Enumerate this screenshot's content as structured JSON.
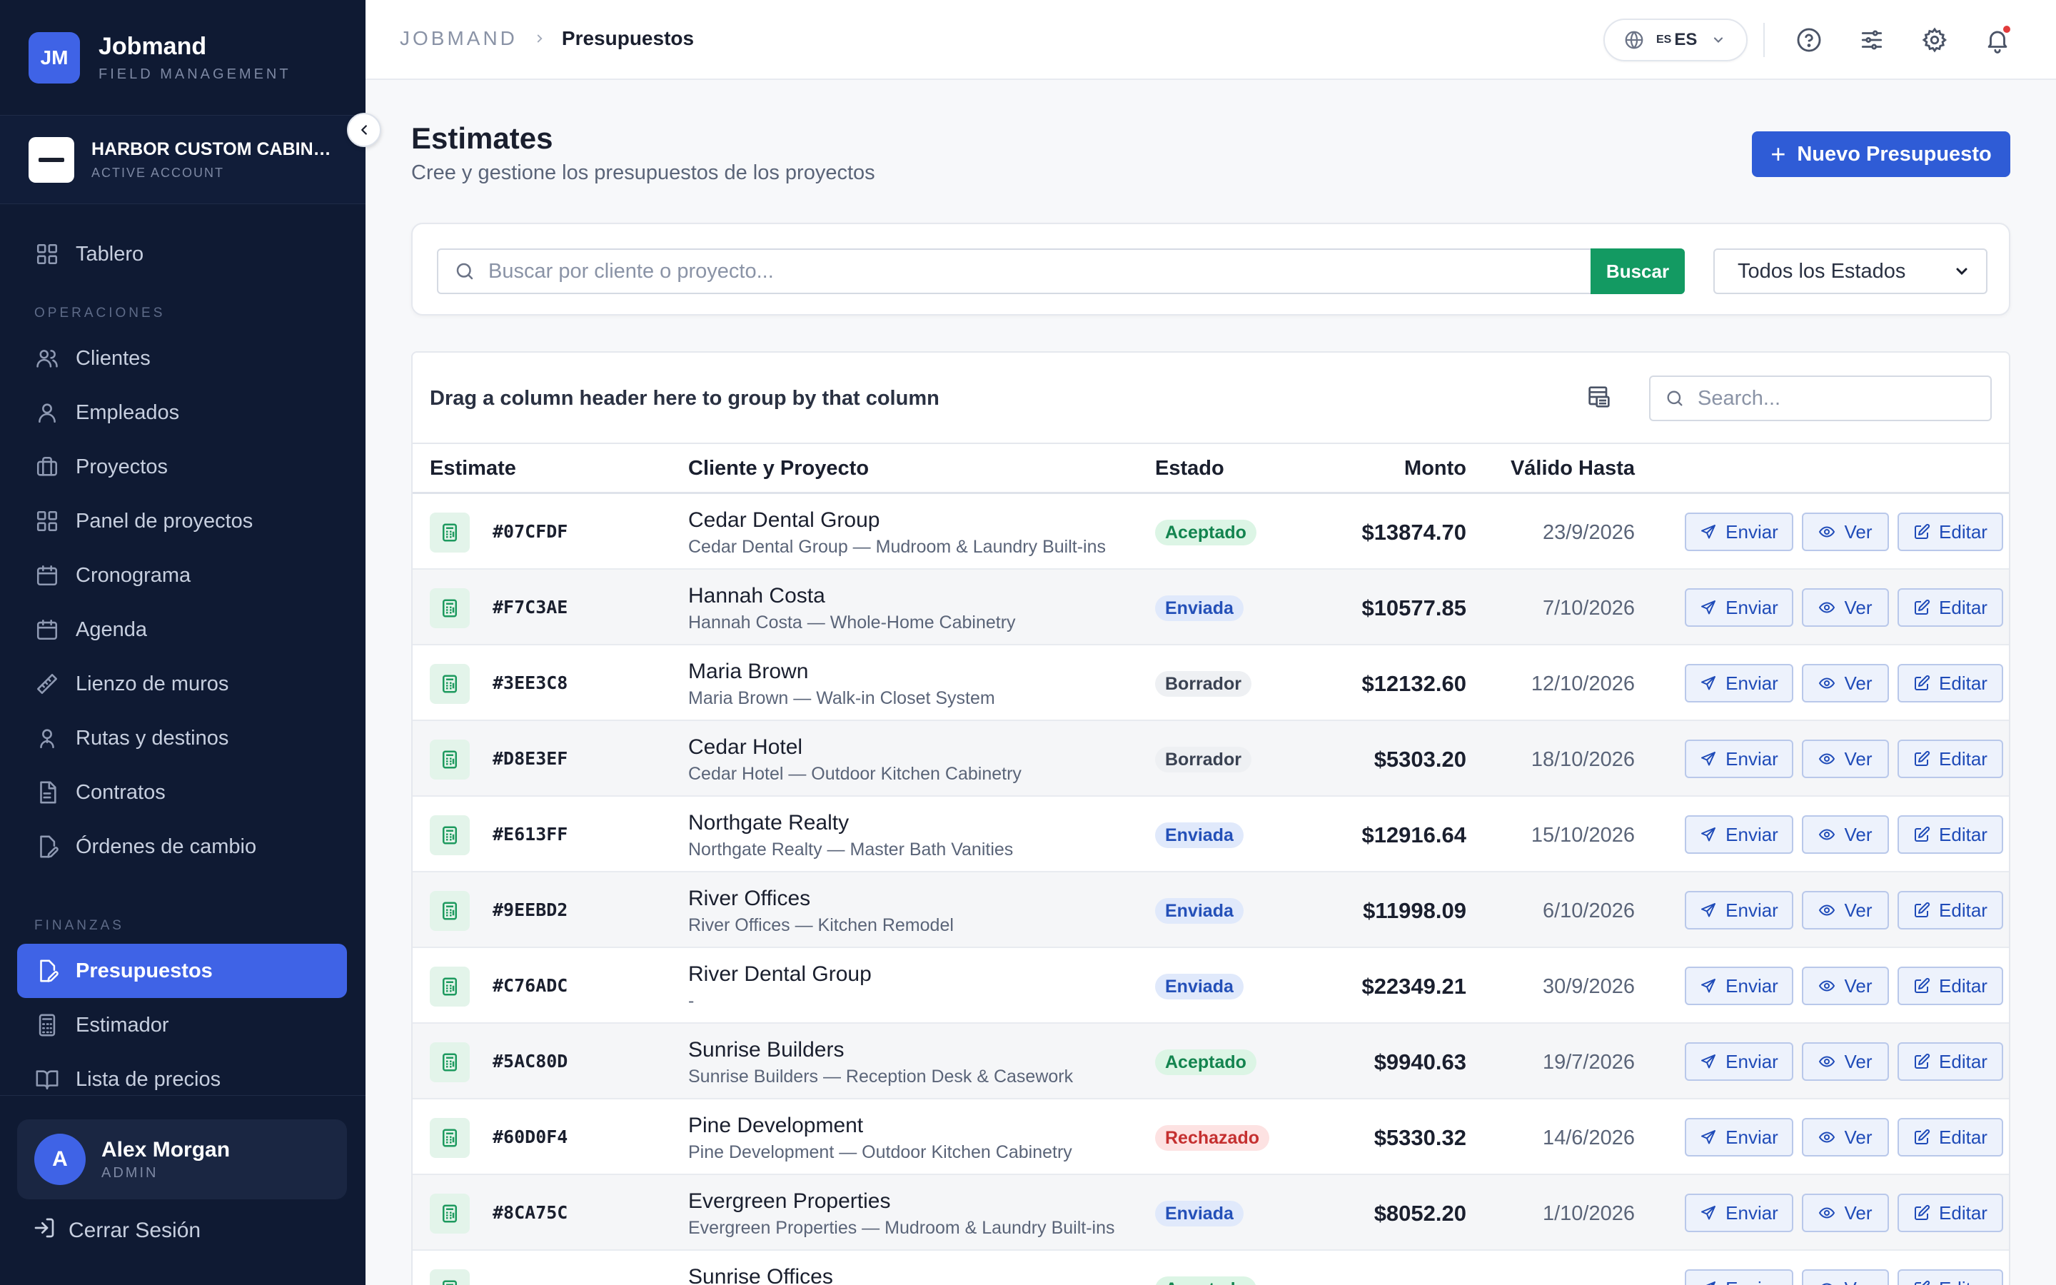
{
  "sidebar": {
    "brand_initials": "JM",
    "brand_name": "Jobmand",
    "brand_sub": "FIELD MANAGEMENT",
    "account_name": "HARBOR CUSTOM CABINETRY",
    "account_sub": "ACTIVE ACCOUNT",
    "nav_top": {
      "label": "Tablero",
      "icon": "grid-icon"
    },
    "section_ops": "OPERACIONES",
    "ops": [
      {
        "label": "Clientes",
        "icon": "users-icon"
      },
      {
        "label": "Empleados",
        "icon": "user-icon"
      },
      {
        "label": "Proyectos",
        "icon": "briefcase-icon"
      },
      {
        "label": "Panel de proyectos",
        "icon": "grid-icon"
      },
      {
        "label": "Cronograma",
        "icon": "calendar-icon"
      },
      {
        "label": "Agenda",
        "icon": "calendar-icon"
      },
      {
        "label": "Lienzo de muros",
        "icon": "ruler-icon"
      },
      {
        "label": "Rutas y destinos",
        "icon": "map-pin-icon"
      },
      {
        "label": "Contratos",
        "icon": "file-icon"
      },
      {
        "label": "Órdenes de cambio",
        "icon": "file-edit-icon"
      }
    ],
    "section_fin": "FINANZAS",
    "fin": [
      {
        "label": "Presupuestos",
        "icon": "file-edit-icon",
        "active": true
      },
      {
        "label": "Estimador",
        "icon": "calculator-icon"
      },
      {
        "label": "Lista de precios",
        "icon": "book-icon"
      }
    ],
    "user_initial": "A",
    "user_name": "Alex Morgan",
    "user_role": "ADMIN",
    "logout": "Cerrar Sesión"
  },
  "topbar": {
    "crumb_root": "JOBMAND",
    "crumb_current": "Presupuestos",
    "lang_flag": "ES",
    "lang_code": "ES"
  },
  "page": {
    "title": "Estimates",
    "subtitle": "Cree y gestione los presupuestos de los proyectos",
    "new_button": "Nuevo Presupuesto",
    "search_placeholder": "Buscar por cliente o proyecto...",
    "search_button": "Buscar",
    "status_select": "Todos los Estados"
  },
  "grid": {
    "group_hint": "Drag a column header here to group by that column",
    "search_placeholder": "Search...",
    "columns": [
      "Estimate",
      "Cliente y Proyecto",
      "Estado",
      "Monto",
      "Válido Hasta"
    ],
    "actions": {
      "send": "Enviar",
      "view": "Ver",
      "edit": "Editar"
    },
    "rows": [
      {
        "code": "#07CFDF",
        "client": "Cedar Dental Group",
        "project": "Cedar Dental Group — Mudroom & Laundry Built-ins",
        "status": "Aceptado",
        "amount": "$13874.70",
        "valid": "23/9/2026"
      },
      {
        "code": "#F7C3AE",
        "client": "Hannah Costa",
        "project": "Hannah Costa — Whole-Home Cabinetry",
        "status": "Enviada",
        "amount": "$10577.85",
        "valid": "7/10/2026"
      },
      {
        "code": "#3EE3C8",
        "client": "Maria Brown",
        "project": "Maria Brown — Walk-in Closet System",
        "status": "Borrador",
        "amount": "$12132.60",
        "valid": "12/10/2026"
      },
      {
        "code": "#D8E3EF",
        "client": "Cedar Hotel",
        "project": "Cedar Hotel — Outdoor Kitchen Cabinetry",
        "status": "Borrador",
        "amount": "$5303.20",
        "valid": "18/10/2026"
      },
      {
        "code": "#E613FF",
        "client": "Northgate Realty",
        "project": "Northgate Realty — Master Bath Vanities",
        "status": "Enviada",
        "amount": "$12916.64",
        "valid": "15/10/2026"
      },
      {
        "code": "#9EEBD2",
        "client": "River Offices",
        "project": "River Offices — Kitchen Remodel",
        "status": "Enviada",
        "amount": "$11998.09",
        "valid": "6/10/2026"
      },
      {
        "code": "#C76ADC",
        "client": "River Dental Group",
        "project": "-",
        "status": "Enviada",
        "amount": "$22349.21",
        "valid": "30/9/2026"
      },
      {
        "code": "#5AC80D",
        "client": "Sunrise Builders",
        "project": "Sunrise Builders — Reception Desk & Casework",
        "status": "Aceptado",
        "amount": "$9940.63",
        "valid": "19/7/2026"
      },
      {
        "code": "#60D0F4",
        "client": "Pine Development",
        "project": "Pine Development — Outdoor Kitchen Cabinetry",
        "status": "Rechazado",
        "amount": "$5330.32",
        "valid": "14/6/2026"
      },
      {
        "code": "#8CA75C",
        "client": "Evergreen Properties",
        "project": "Evergreen Properties — Mudroom & Laundry Built-ins",
        "status": "Enviada",
        "amount": "$8052.20",
        "valid": "1/10/2026"
      },
      {
        "code": "",
        "client": "Sunrise Offices",
        "project": "",
        "status": "Aceptado",
        "amount": "",
        "valid": ""
      }
    ]
  },
  "status_colors": {
    "Aceptado": {
      "bg": "#dcf5e5",
      "fg": "#13844f"
    },
    "Enviada": {
      "bg": "#e0e9fb",
      "fg": "#2450b8"
    },
    "Borrador": {
      "bg": "#eef0f3",
      "fg": "#3a4252"
    },
    "Rechazado": {
      "bg": "#fde2e2",
      "fg": "#c53030"
    }
  },
  "colors": {
    "accent": "#3f63e6",
    "sidebar": "#0f1a33",
    "success": "#139a62"
  }
}
